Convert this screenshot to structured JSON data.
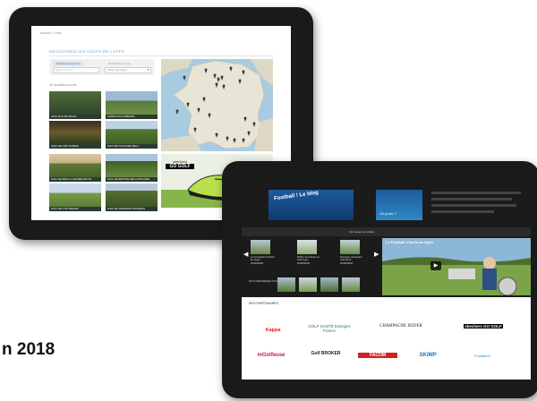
{
  "tablet1": {
    "breadcrumb": "Accueil > Golfs",
    "section_title": "DÉCOUVREZ LES GOLFS DE L'AFFS",
    "filters": {
      "tab_active": "Recherche par nom",
      "tab_inactive": "Recherche par lieu",
      "input_placeholder": "Entrez un nom",
      "select_value": "Filtrer par région"
    },
    "result_count": "30 résultats trouvés",
    "cards": [
      {
        "caption": "GOLF DU FORT ROYAL"
      },
      {
        "caption": "JARDIN GOLF AMIENOIS"
      },
      {
        "caption": "GOLF DE L'OM TOURNOI"
      },
      {
        "caption": "GOLF DE TOULOUSE SEILH"
      },
      {
        "caption": "GOLF DE PARIS LA GRANDE MOTTE"
      },
      {
        "caption": "GOLF DE MONTPELLIER FONTCAUDE"
      },
      {
        "caption": "GOLF DE LYON VERGER"
      },
      {
        "caption": "GOLF DE VAUDREUIL PROVENCE"
      }
    ],
    "promo": {
      "brand_top": "skechers",
      "brand_bottom": "GO GOLF"
    }
  },
  "tablet2": {
    "header_caption": "Football ! Le blog",
    "side_caption": "Où jouer ?",
    "video_section_label": "Voir toutes les vidéos",
    "main_video_title": "Le Football s'invite au Open",
    "thumbs": [
      {
        "caption": "Les Footgolf s'invitent au Open",
        "date": "02/06/2018"
      },
      {
        "caption": "Muller de France au Golf Open",
        "date": "02/06/2018"
      },
      {
        "caption": "Nouveau partenaire Golf Paris",
        "date": "02/06/2018"
      }
    ],
    "photos_label": "NOS DERNIÈRES PHOTOS",
    "partners_label": "NOS PARTENAIRES",
    "partners": [
      "Kappa",
      "GOLF SANTÉ Energies France",
      "CHAMPAGNE JEEPER",
      "skechers GO GOLF",
      "mGolfeuse",
      "Golf BROKER",
      "FACOM",
      "SKIMP",
      "Fondation"
    ]
  },
  "caption": "n 2018"
}
